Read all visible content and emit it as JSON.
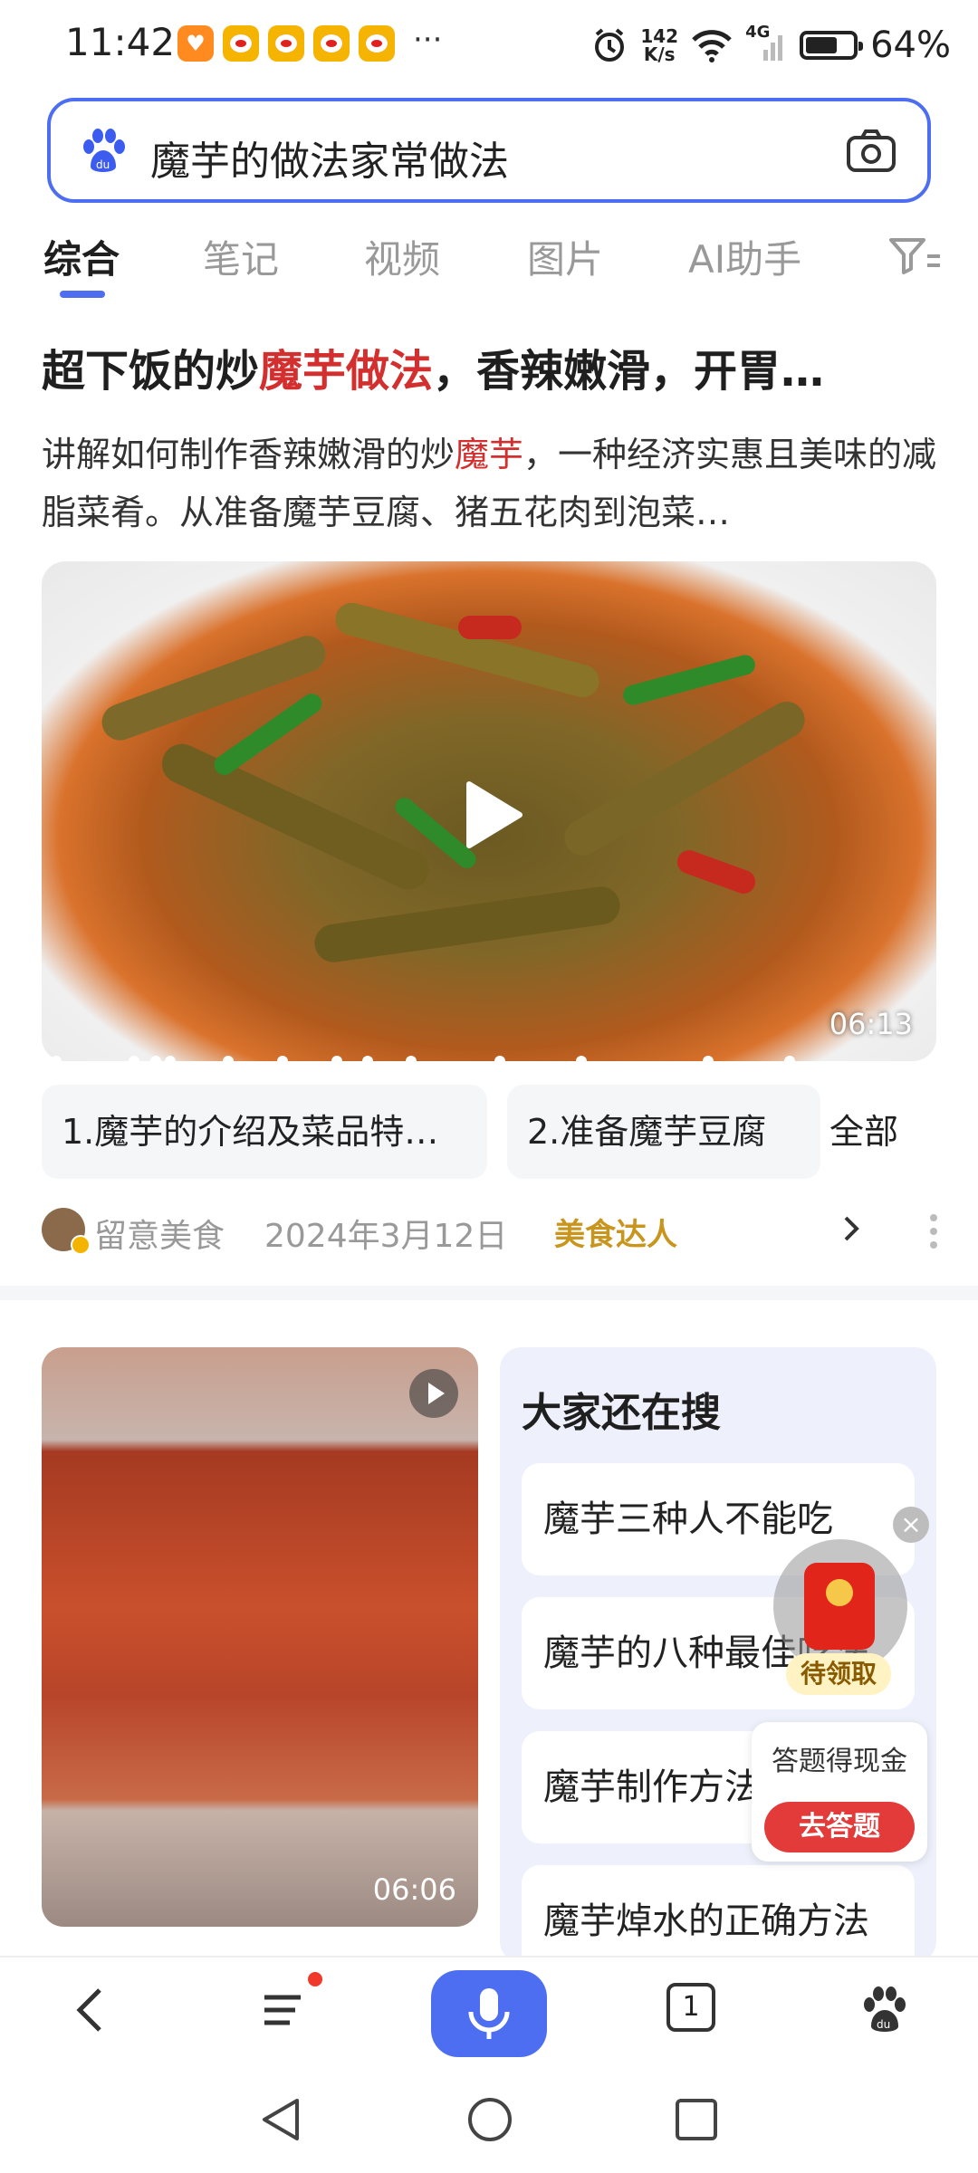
{
  "status_bar": {
    "time": "11:42",
    "more": "···",
    "net_speed_value": "142",
    "net_speed_unit": "K/s",
    "network": "4G",
    "battery": "64%"
  },
  "search": {
    "query": "魔芋的做法家常做法"
  },
  "tabs": [
    "综合",
    "笔记",
    "视频",
    "图片",
    "AI助手"
  ],
  "result": {
    "title_pre": "超下饭的炒",
    "title_hl": "魔芋做法",
    "title_post": "，香辣嫩滑，开胃…",
    "desc_pre": "讲解如何制作香辣嫩滑的炒",
    "desc_hl": "魔芋",
    "desc_post": "，一种经济实惠且美味的减脂菜肴。从准备魔芋豆腐、猪五花肉到泡菜…",
    "duration": "06:13",
    "chapters": [
      "1.魔芋的介绍及菜品特…",
      "2.准备魔芋豆腐"
    ],
    "all_label": "全部",
    "author": "留意美食",
    "date": "2024年3月12日",
    "tag": "美食达人"
  },
  "second_video": {
    "duration": "06:06"
  },
  "also_search": {
    "title": "大家还在搜",
    "items": [
      "魔芋三种人不能吃",
      "魔芋的八种最佳吃法",
      "魔芋制作方法",
      "魔芋焯水的正确方法"
    ]
  },
  "widget": {
    "pending": "待领取",
    "cash_text": "答题得现金",
    "answer_btn": "去答题"
  },
  "bottom_nav": {
    "tab_count": "1"
  },
  "colors": {
    "accent": "#4e6ef2",
    "highlight": "#d32f2f",
    "tag": "#c8961e"
  }
}
